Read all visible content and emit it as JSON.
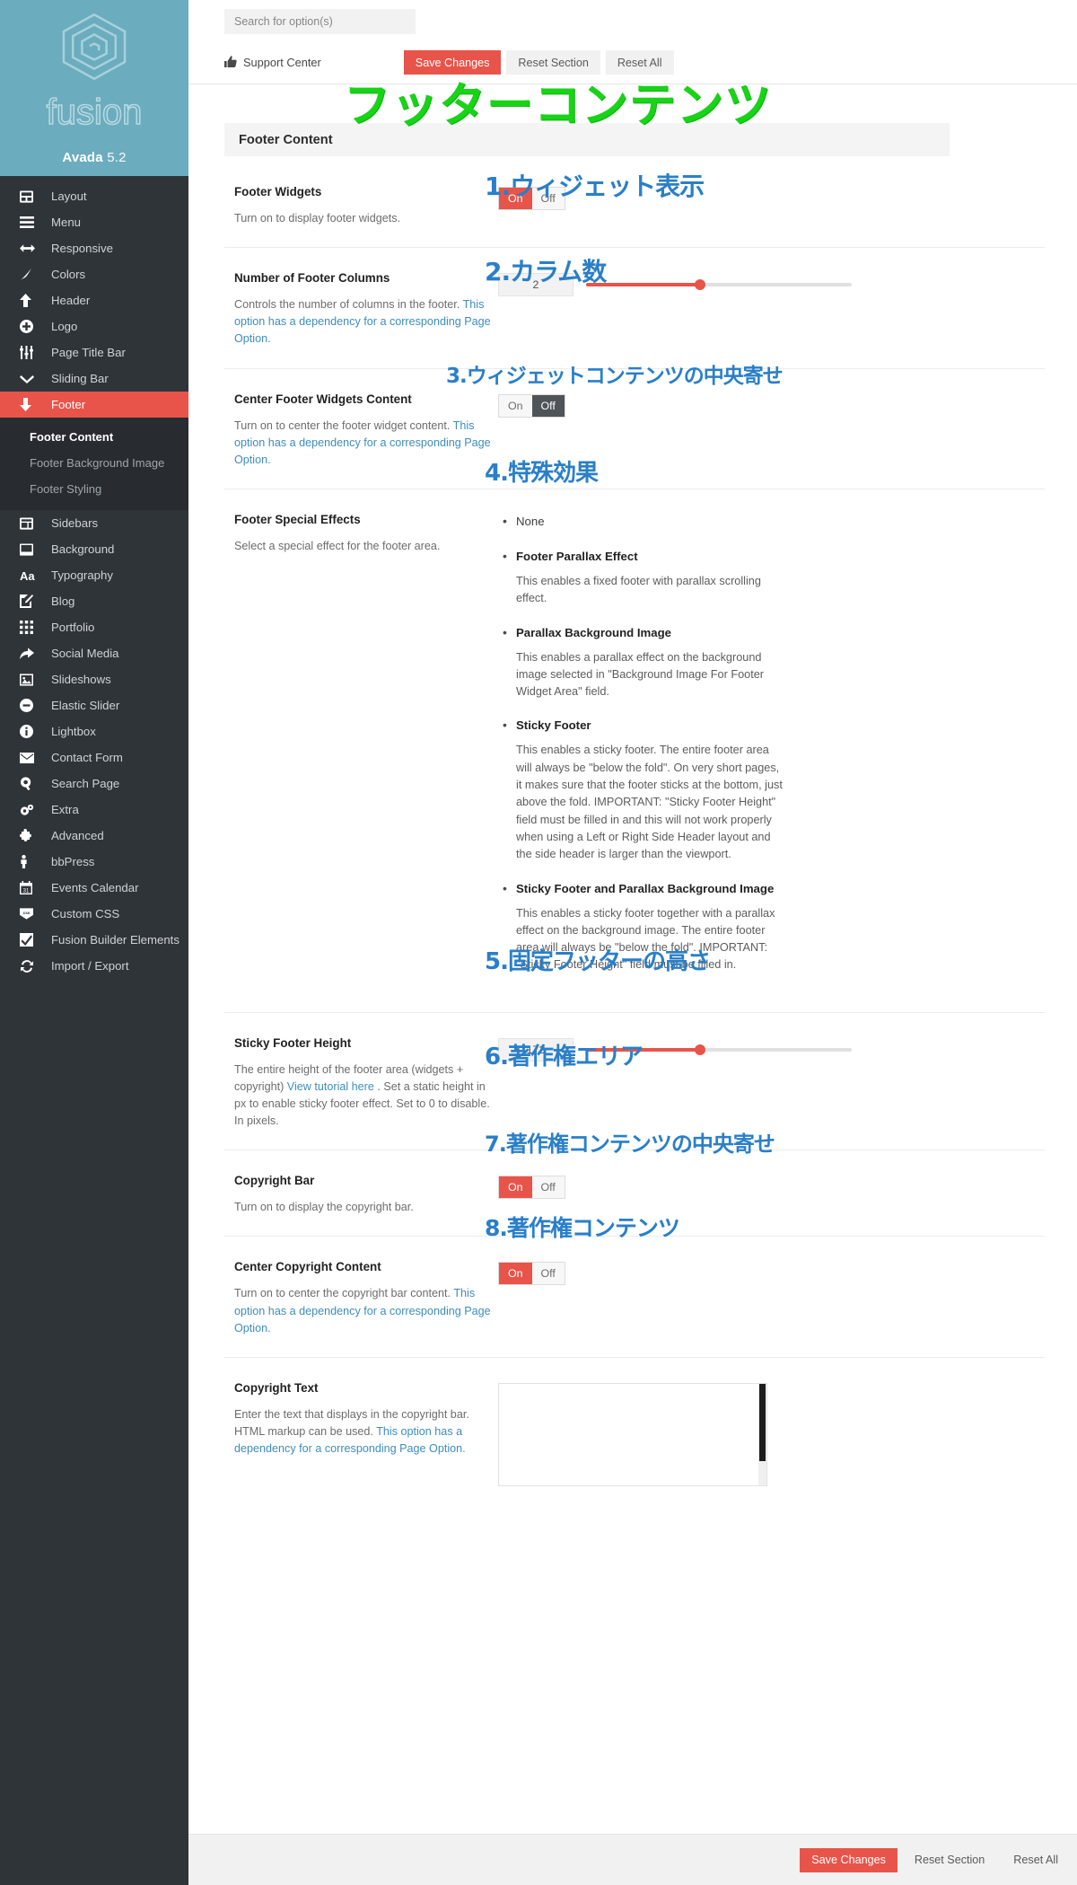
{
  "brand": {
    "name": "fusion",
    "product": "Avada",
    "version": "5.2"
  },
  "search": {
    "placeholder": "Search for option(s)",
    "value": ""
  },
  "toolbar": {
    "support_label": "Support Center",
    "save_label": "Save Changes",
    "reset_section_label": "Reset Section",
    "reset_all_label": "Reset All"
  },
  "sidebar": {
    "items": [
      {
        "label": "Layout",
        "icon": "layout-icon"
      },
      {
        "label": "Menu",
        "icon": "menu-icon"
      },
      {
        "label": "Responsive",
        "icon": "arrows-horizontal-icon"
      },
      {
        "label": "Colors",
        "icon": "brush-icon"
      },
      {
        "label": "Header",
        "icon": "arrow-up-icon"
      },
      {
        "label": "Logo",
        "icon": "plus-circle-icon"
      },
      {
        "label": "Page Title Bar",
        "icon": "sliders-icon"
      },
      {
        "label": "Sliding Bar",
        "icon": "chevron-down-icon"
      },
      {
        "label": "Footer",
        "icon": "arrow-down-icon",
        "active": true
      },
      {
        "label": "Sidebars",
        "icon": "sidebar-icon"
      },
      {
        "label": "Background",
        "icon": "window-icon"
      },
      {
        "label": "Typography",
        "icon": "aa-icon"
      },
      {
        "label": "Blog",
        "icon": "pencil-square-icon"
      },
      {
        "label": "Portfolio",
        "icon": "grid-icon"
      },
      {
        "label": "Social Media",
        "icon": "share-arrow-icon"
      },
      {
        "label": "Slideshows",
        "icon": "image-icon"
      },
      {
        "label": "Elastic Slider",
        "icon": "minus-circle-icon"
      },
      {
        "label": "Lightbox",
        "icon": "info-circle-icon"
      },
      {
        "label": "Contact Form",
        "icon": "envelope-icon"
      },
      {
        "label": "Search Page",
        "icon": "search-icon"
      },
      {
        "label": "Extra",
        "icon": "gears-icon"
      },
      {
        "label": "Advanced",
        "icon": "puzzle-icon"
      },
      {
        "label": "bbPress",
        "icon": "person-icon"
      },
      {
        "label": "Events Calendar",
        "icon": "calendar-icon"
      },
      {
        "label": "Custom CSS",
        "icon": "css-icon"
      },
      {
        "label": "Fusion Builder Elements",
        "icon": "check-square-icon"
      },
      {
        "label": "Import / Export",
        "icon": "refresh-icon"
      }
    ],
    "subitems": [
      {
        "label": "Footer Content",
        "current": true
      },
      {
        "label": "Footer Background Image",
        "current": false
      },
      {
        "label": "Footer Styling",
        "current": false
      }
    ]
  },
  "section": {
    "title": "Footer Content"
  },
  "annotations": {
    "title": "フッターコンテンツ",
    "a1": "1.ウィジェット表示",
    "a2": "2.カラム数",
    "a3": "3.ウィジェットコンテンツの中央寄せ",
    "a4": "4.特殊効果",
    "a5": "5.固定フッターの高さ",
    "a6": "6.著作権エリア",
    "a7": "7.著作権コンテンツの中央寄せ",
    "a8": "8.著作権コンテンツ",
    "title_color": "#18d318",
    "label_color": "#2a7fc9"
  },
  "options": {
    "footer_widgets": {
      "title": "Footer Widgets",
      "desc": "Turn on to display footer widgets.",
      "on_label": "On",
      "off_label": "Off",
      "value": "On"
    },
    "footer_columns": {
      "title": "Number of Footer Columns",
      "desc_plain": "Controls the number of columns in the footer. ",
      "desc_link": "This option has a dependency for a corresponding Page Option.",
      "value": "2",
      "slider_percent": 43
    },
    "center_widgets": {
      "title": "Center Footer Widgets Content",
      "desc_plain": "Turn on to center the footer widget content. ",
      "desc_link": "This option has a dependency for a corresponding Page Option.",
      "on_label": "On",
      "off_label": "Off",
      "value": "Off"
    },
    "special_effects": {
      "title": "Footer Special Effects",
      "desc": "Select a special effect for the footer area.",
      "items": [
        {
          "name": "None",
          "bold": false,
          "body": ""
        },
        {
          "name": "Footer Parallax Effect",
          "bold": true,
          "body": "This enables a fixed footer with parallax scrolling effect."
        },
        {
          "name": "Parallax Background Image",
          "bold": true,
          "body": "This enables a parallax effect on the background image selected in \"Background Image For Footer Widget Area\" field."
        },
        {
          "name": "Sticky Footer",
          "bold": true,
          "body": "This enables a sticky footer. The entire footer area will always be \"below the fold\". On very short pages, it makes sure that the footer sticks at the bottom, just above the fold. IMPORTANT: \"Sticky Footer Height\" field must be filled in and this will not work properly when using a Left or Right Side Header layout and the side header is larger than the viewport."
        },
        {
          "name": "Sticky Footer and Parallax Background Image",
          "bold": true,
          "body": "This enables a sticky footer together with a parallax effect on the background image. The entire footer area will always be \"below the fold\". IMPORTANT: \"Sticky Footer Height\" field must be filled in."
        }
      ]
    },
    "sticky_height": {
      "title": "Sticky Footer Height",
      "desc_part1": "The entire height of the footer area (widgets + copyright) ",
      "desc_link": "View tutorial here",
      "desc_part2": " . Set a static height in px to enable sticky footer effect. Set to 0 to disable. In pixels.",
      "value": "172",
      "slider_percent": 43
    },
    "copyright_bar": {
      "title": "Copyright Bar",
      "desc": "Turn on to display the copyright bar.",
      "on_label": "On",
      "off_label": "Off",
      "value": "On"
    },
    "center_copyright": {
      "title": "Center Copyright Content",
      "desc_plain": "Turn on to center the copyright bar content. ",
      "desc_link": "This option has a dependency for a corresponding Page Option.",
      "on_label": "On",
      "off_label": "Off",
      "value": "On"
    },
    "copyright_text": {
      "title": "Copyright Text",
      "desc_plain": "Enter the text that displays in the copyright bar. HTML markup can be used. ",
      "desc_link": "This option has a dependency for a corresponding Page Option.",
      "value": ""
    }
  }
}
